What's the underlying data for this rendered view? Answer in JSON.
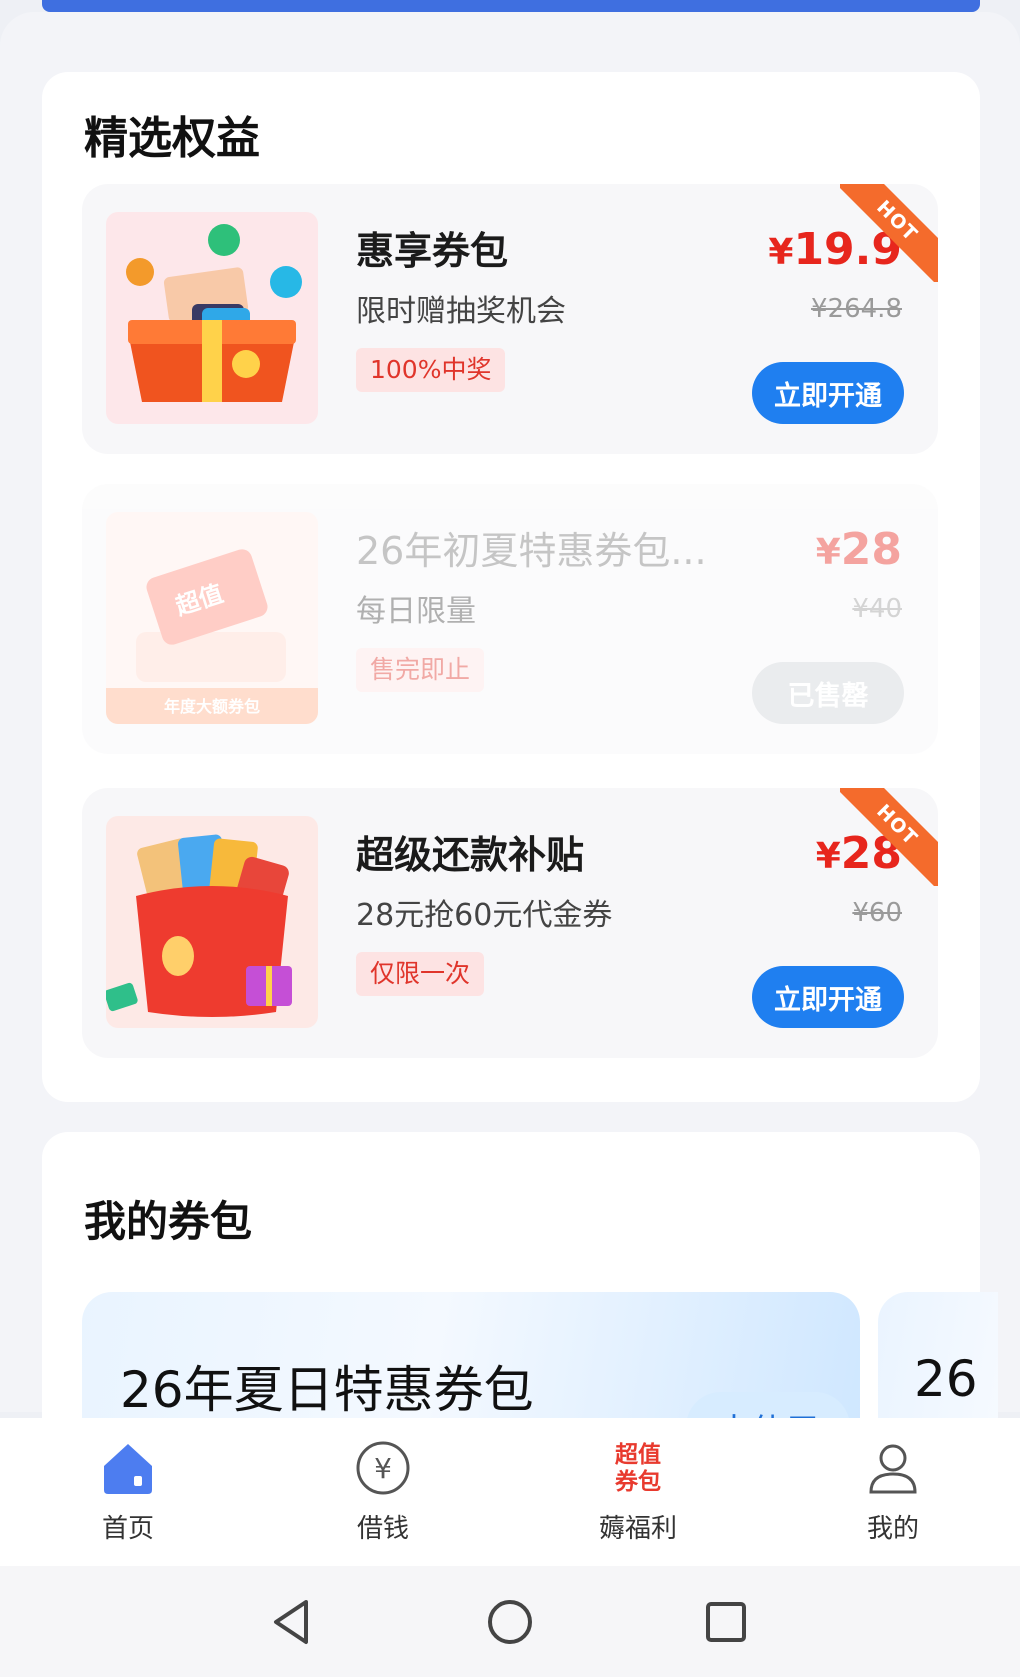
{
  "featured": {
    "title": "精选权益",
    "items": [
      {
        "title": "惠享券包",
        "subtitle": "限时赠抽奖机会",
        "tag": "100%中奖",
        "price": "19.9",
        "currency": "¥",
        "original_price": "¥264.8",
        "button": "立即开通",
        "badge": "HOT",
        "thumb_icon": "gift-box-icon"
      },
      {
        "title": "26年初夏特惠券包...",
        "subtitle": "每日限量",
        "tag": "售完即止",
        "price": "28",
        "currency": "¥",
        "original_price": "¥40",
        "button": "已售罄",
        "thumb_icon": "ticket-icon",
        "thumb_text": "超值",
        "thumb_caption": "年度大额券包"
      },
      {
        "title": "超级还款补贴",
        "subtitle": "28元抢60元代金券",
        "tag": "仅限一次",
        "price": "28",
        "currency": "¥",
        "original_price": "¥60",
        "button": "立即开通",
        "badge": "HOT",
        "thumb_icon": "red-wallet-icon"
      }
    ]
  },
  "my_coupons": {
    "title": "我的券包",
    "coupon": {
      "title": "26年夏日特惠券包",
      "action": "去使用"
    },
    "coupon_next": {
      "title": "26"
    }
  },
  "tabbar": {
    "items": [
      {
        "label": "首页",
        "icon": "home-icon",
        "active": true
      },
      {
        "label": "借钱",
        "icon": "yen-circle-icon"
      },
      {
        "label": "薅福利",
        "icon": "promo-icon",
        "icon_text": "超值\n券包"
      },
      {
        "label": "我的",
        "icon": "profile-icon"
      }
    ]
  },
  "colors": {
    "accent_blue": "#1f7ff0",
    "price_red": "#e7261d",
    "hot_orange": "#f46b2c"
  }
}
